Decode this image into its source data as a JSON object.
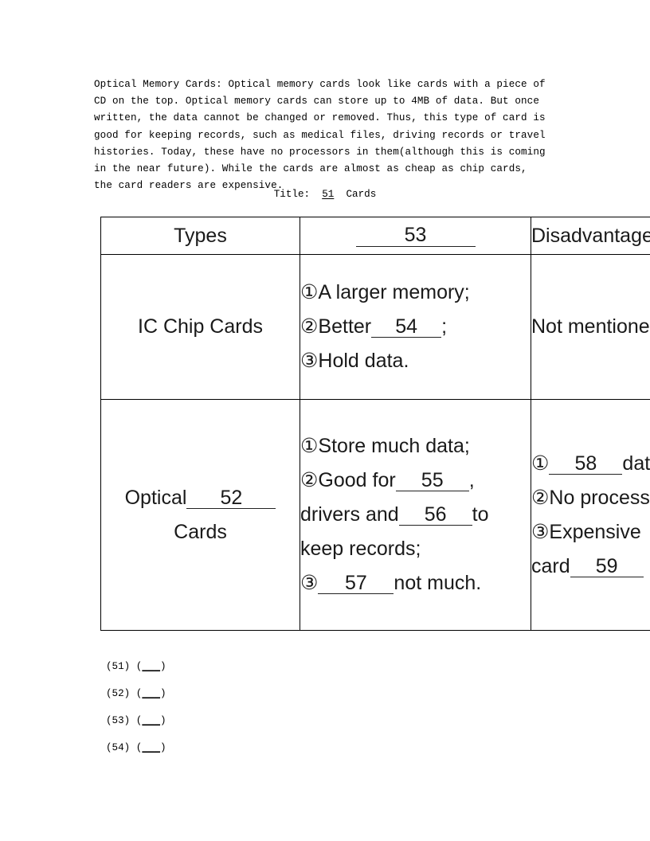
{
  "passage": {
    "text": "Optical Memory Cards: Optical memory cards look like cards with a piece of CD on the top. Optical memory cards can store up to 4MB of data. But once written, the data cannot be changed or removed. Thus, this type of card is good for keeping records, such as medical files, driving records or travel histories. Today, these have no processors in them(although this is coming in the near future). While the cards are almost as cheap as chip cards, the card readers are expensive."
  },
  "title_line": {
    "label": "Title:",
    "blank": "51",
    "suffix": "Cards"
  },
  "table": {
    "header": {
      "types": "Types",
      "advantages_blank": "53",
      "disadvantages": "Disadvantages"
    },
    "rows": [
      {
        "type_name": "IC Chip Cards",
        "features": {
          "item1_marker": "①",
          "item1_text": "A larger memory;",
          "item2_marker": "②",
          "item2_prefix": "Better",
          "item2_blank": "54",
          "item2_suffix": ";",
          "item3_marker": "③",
          "item3_text": "Hold data."
        },
        "disadvantages": "Not mentioned"
      },
      {
        "type_prefix": "Optical",
        "type_blank": "52",
        "type_suffix": "Cards",
        "features": {
          "item1_marker": "①",
          "item1_text": "Store much data;",
          "item2_marker": "②",
          "item2_prefix": "Good for",
          "item2_blank": "55",
          "item2_mid": ", drivers and",
          "item2_blank2": "56",
          "item2_suffix": "to keep records;",
          "item3_marker": "③",
          "item3_blank": "57",
          "item3_text": "not much."
        },
        "disadvantages": {
          "item1_marker": "①",
          "item1_blank": "58",
          "item1_text": "data;",
          "item2_marker": "②",
          "item2_text": "No processors;",
          "item3_marker": "③",
          "item3_text": "Expensive",
          "item3_line2_prefix": "card",
          "item3_blank": "59"
        }
      }
    ]
  },
  "answers": [
    {
      "number": "(51)",
      "open": "(",
      "blank": "___",
      "close": ")"
    },
    {
      "number": "(52)",
      "open": "(",
      "blank": "___",
      "close": ")"
    },
    {
      "number": "(53)",
      "open": "(",
      "blank": "___",
      "close": ")"
    },
    {
      "number": "(54)",
      "open": "(",
      "blank": "___",
      "close": ")"
    }
  ]
}
